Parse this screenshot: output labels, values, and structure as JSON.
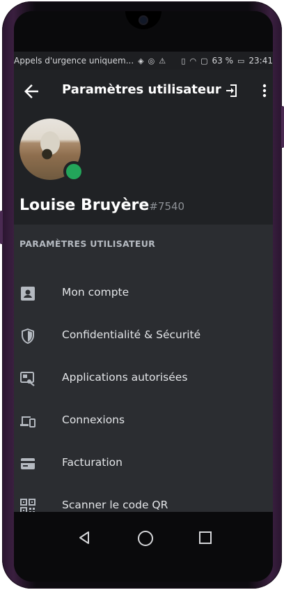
{
  "status_bar": {
    "notification_text": "Appels d'urgence uniquem...",
    "battery_percent": "63 %",
    "time": "23:41"
  },
  "app_bar": {
    "title": "Paramètres utilisateur",
    "back_icon": "arrow-left-icon",
    "logout_icon": "logout-icon",
    "menu_icon": "more-vert-icon"
  },
  "profile": {
    "username": "Louise Bruyère",
    "discriminator": "#7540",
    "status_color": "#23a55a"
  },
  "settings": {
    "section_title": "PARAMÈTRES UTILISATEUR",
    "items": [
      {
        "label": "Mon compte",
        "icon": "account-card-icon"
      },
      {
        "label": "Confidentialité & Sécurité",
        "icon": "shield-icon"
      },
      {
        "label": "Applications autorisées",
        "icon": "authorized-apps-icon"
      },
      {
        "label": "Connexions",
        "icon": "devices-icon"
      },
      {
        "label": "Facturation",
        "icon": "credit-card-icon"
      },
      {
        "label": "Scanner le code QR",
        "icon": "qr-code-icon"
      }
    ]
  },
  "colors": {
    "app_bar": "#202225",
    "list_bg": "#2b2d31",
    "text_primary": "#ffffff",
    "text_muted": "#b5bac1"
  }
}
